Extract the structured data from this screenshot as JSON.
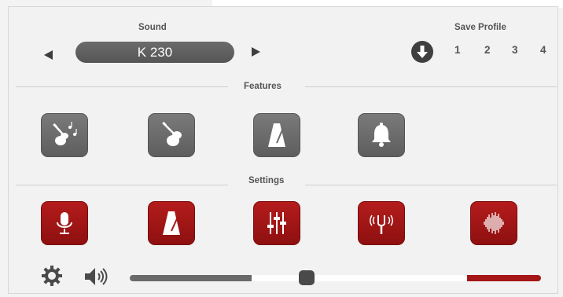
{
  "header": {
    "sound_label": "Sound",
    "sound_value": "K 230",
    "save_profile_label": "Save Profile",
    "profiles": [
      "1",
      "2",
      "3",
      "4"
    ]
  },
  "sections": {
    "features_label": "Features",
    "settings_label": "Settings"
  },
  "features": [
    {
      "icon": "violin-music-icon"
    },
    {
      "icon": "violin-icon"
    },
    {
      "icon": "metronome-icon"
    },
    {
      "icon": "bell-icon"
    }
  ],
  "settings": [
    {
      "icon": "microphone-icon"
    },
    {
      "icon": "metronome-icon"
    },
    {
      "icon": "equalizer-icon"
    },
    {
      "icon": "tuning-fork-icon"
    },
    {
      "icon": "waveform-icon"
    }
  ],
  "footer": {
    "volume_level_fraction": 0.43,
    "range_start_fraction": 0.3,
    "range_end_fraction": 0.82
  },
  "colors": {
    "red": "#a51616",
    "gray": "#6a6a6a",
    "background": "#f2f2f2"
  }
}
